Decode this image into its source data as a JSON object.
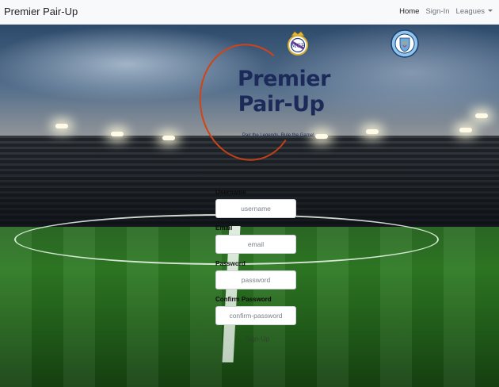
{
  "navbar": {
    "brand": "Premier Pair-Up",
    "links": [
      {
        "label": "Home"
      },
      {
        "label": "Sign-In"
      },
      {
        "label": "Leagues"
      }
    ]
  },
  "logo": {
    "title": "Premier\nPair-Up",
    "tagline": "Pair the Legends, Rule the Game!",
    "crests": [
      "real-madrid-crest-icon",
      "manchester-city-crest-icon"
    ],
    "colors": {
      "title": "#1c2a5a",
      "ring": "#d34316"
    }
  },
  "form": {
    "username_label": "Username",
    "username_placeholder": "username",
    "email_label": "Email",
    "email_placeholder": "email",
    "password_label": "Password",
    "password_placeholder": "password",
    "confirm_label": "Confirm Password",
    "confirm_placeholder": "confirm-password",
    "submit_label": "Sign-Up"
  }
}
